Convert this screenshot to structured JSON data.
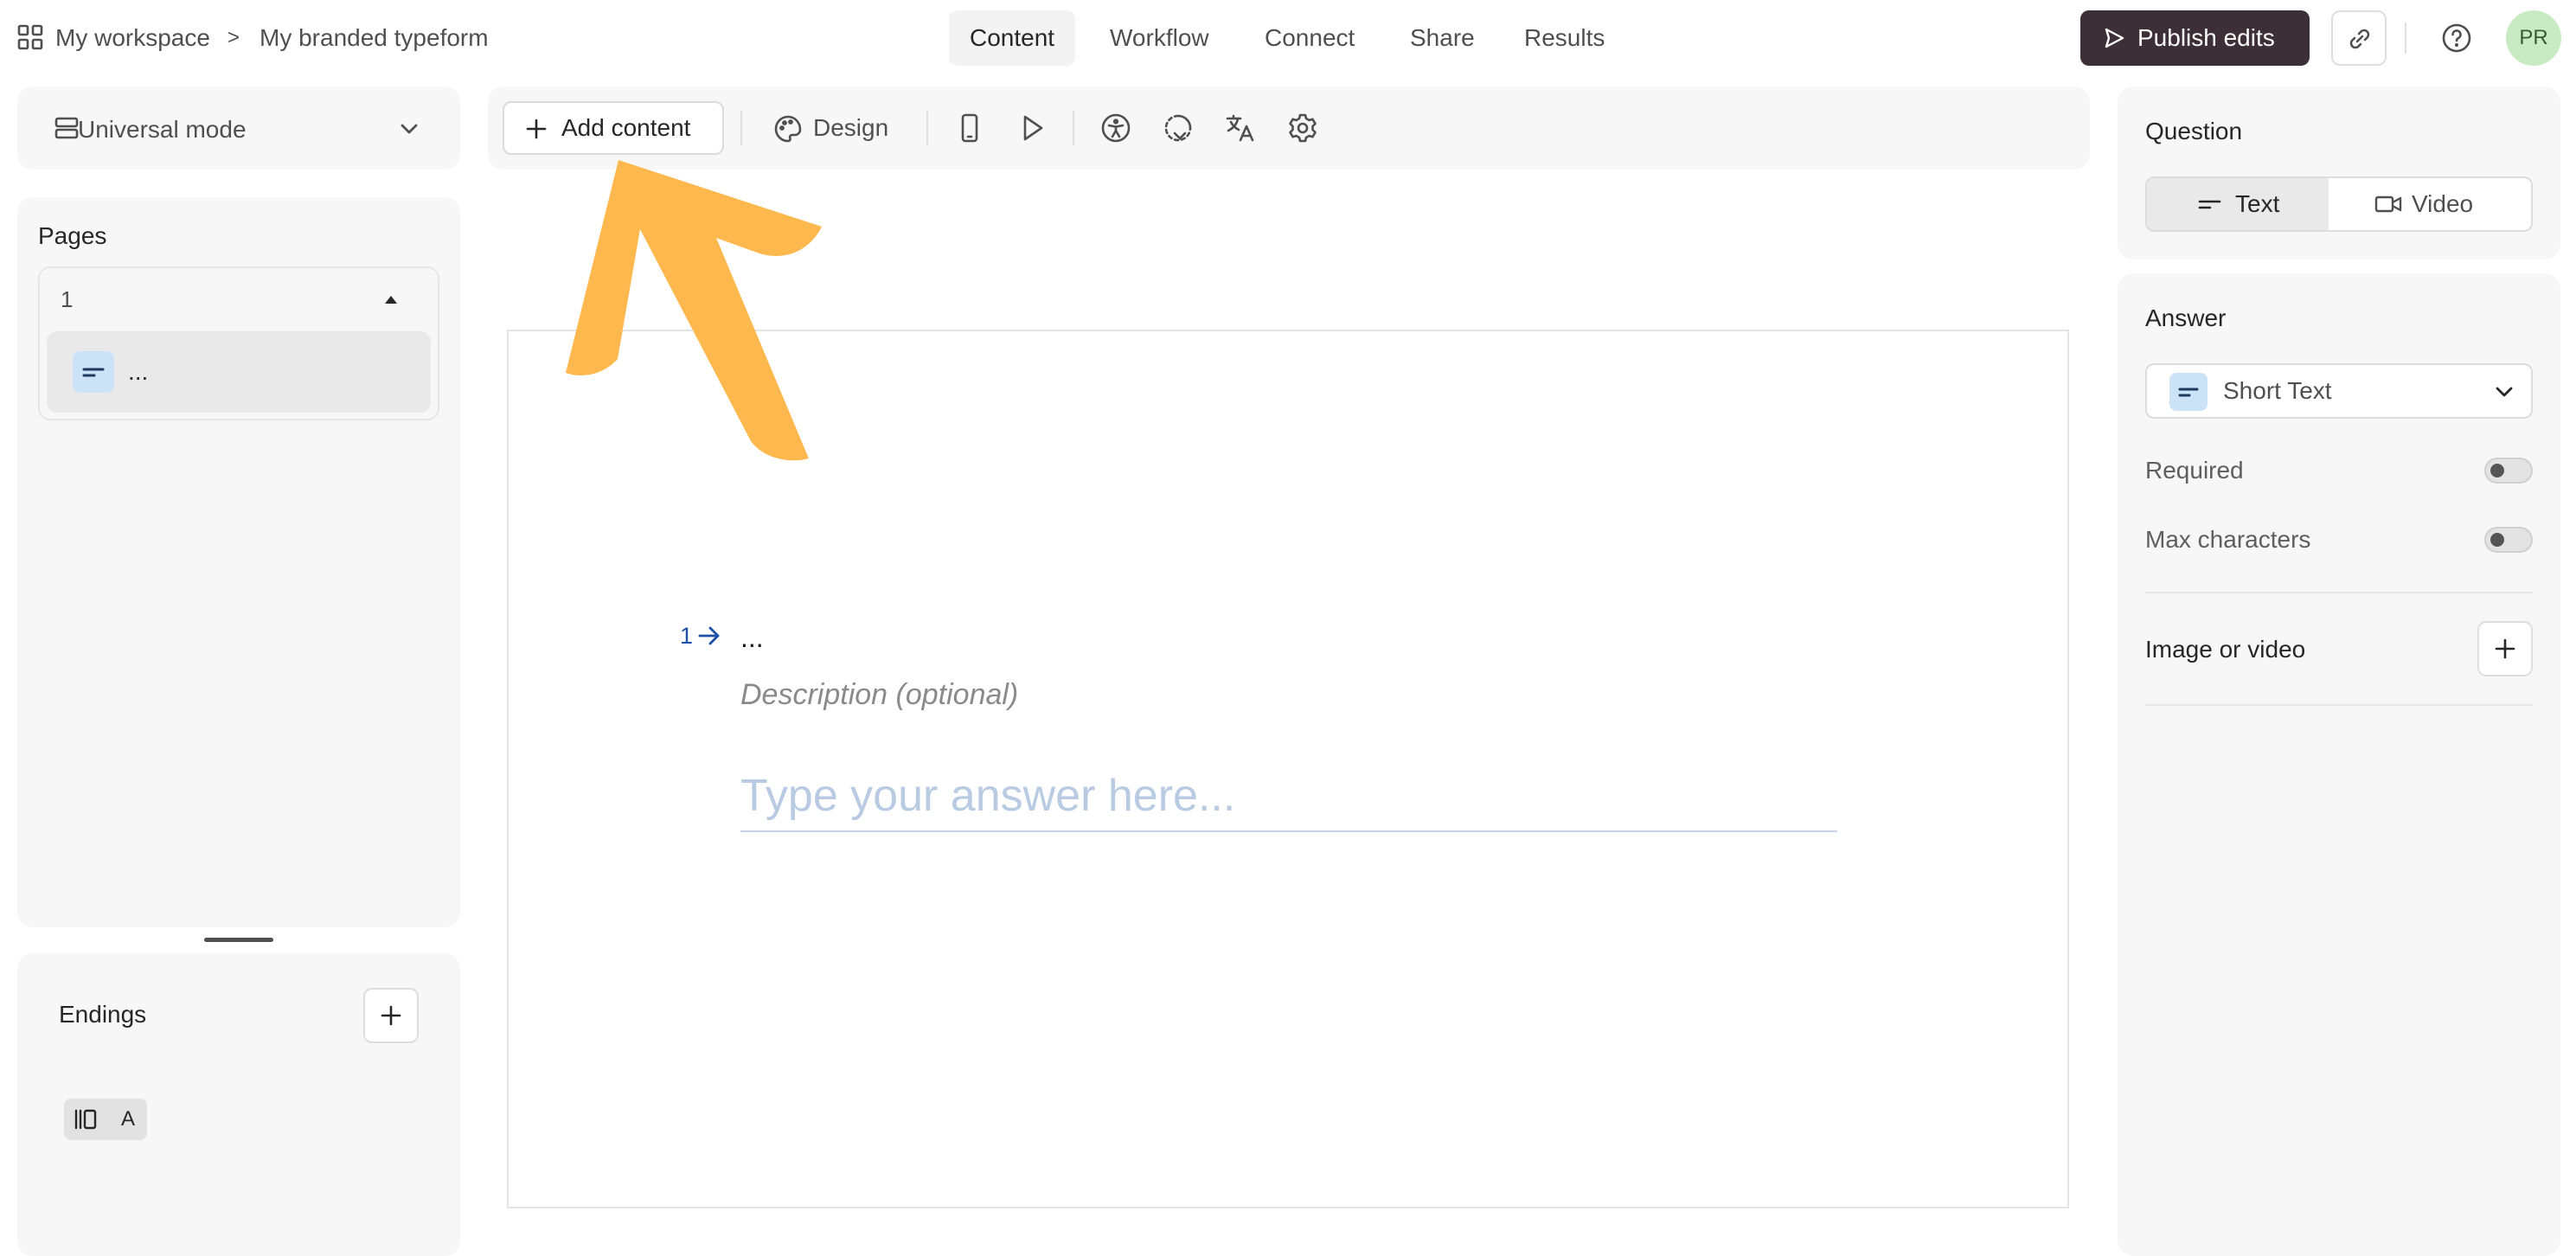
{
  "topbar": {
    "workspace": "My workspace",
    "separator": ">",
    "form_name": "My branded typeform",
    "tabs": [
      {
        "label": "Content",
        "active": true
      },
      {
        "label": "Workflow"
      },
      {
        "label": "Connect"
      },
      {
        "label": "Share"
      },
      {
        "label": "Results"
      }
    ],
    "publish_label": "Publish edits",
    "avatar_initials": "PR"
  },
  "sidebar": {
    "mode_label": "Universal mode",
    "pages_title": "Pages",
    "page_group_number": "1",
    "page_item_label": "...",
    "endings_title": "Endings",
    "ending_chip_label": "A"
  },
  "toolbar": {
    "add_content_label": "Add content",
    "design_label": "Design"
  },
  "canvas": {
    "question_number": "1",
    "question_title": "...",
    "description_placeholder": "Description (optional)",
    "answer_placeholder": "Type your answer here..."
  },
  "settings": {
    "question_heading": "Question",
    "question_type_options": [
      "Text",
      "Video"
    ],
    "question_type_selected": "Text",
    "answer_heading": "Answer",
    "answer_type": "Short Text",
    "required_label": "Required",
    "required_on": false,
    "max_chars_label": "Max characters",
    "max_chars_on": false,
    "media_label": "Image or video"
  },
  "colors": {
    "accent_arrow": "#ffb84d",
    "publish_bg": "#3d2f38",
    "question_number": "#1c4fa6",
    "avatar_bg": "#c9ebc4"
  }
}
